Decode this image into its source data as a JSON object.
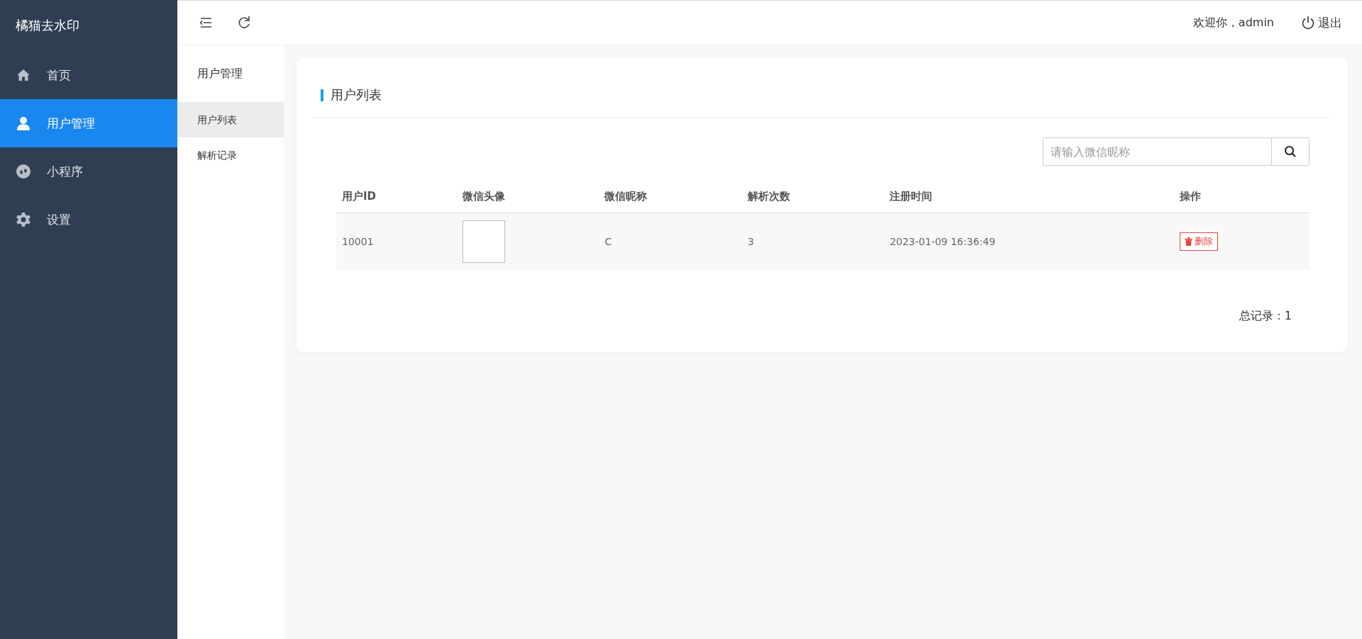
{
  "sidebar": {
    "title": "橘猫去水印",
    "items": [
      {
        "label": "首页",
        "selected": false
      },
      {
        "label": "用户管理",
        "selected": true
      },
      {
        "label": "小程序",
        "selected": false
      },
      {
        "label": "设置",
        "selected": false
      }
    ]
  },
  "top_bar": {
    "welcome": "欢迎你，admin",
    "logout": "退出"
  },
  "sub_nav": {
    "title": "用户管理",
    "items": [
      {
        "label": "用户列表",
        "selected": true
      },
      {
        "label": "解析记录",
        "selected": false
      }
    ]
  },
  "card": {
    "title": "用户列表",
    "search": {
      "placeholder": "请输入微信昵称"
    },
    "table": {
      "columns": [
        "用户ID",
        "微信头像",
        "微信昵称",
        "解析次数",
        "注册时间",
        "操作"
      ],
      "rows": [
        {
          "user_id": "10001",
          "nickname": "C",
          "parse_count": "3",
          "registered": "2023-01-09 16:36:49",
          "action": "删除"
        }
      ]
    },
    "total": "总记录：1"
  }
}
